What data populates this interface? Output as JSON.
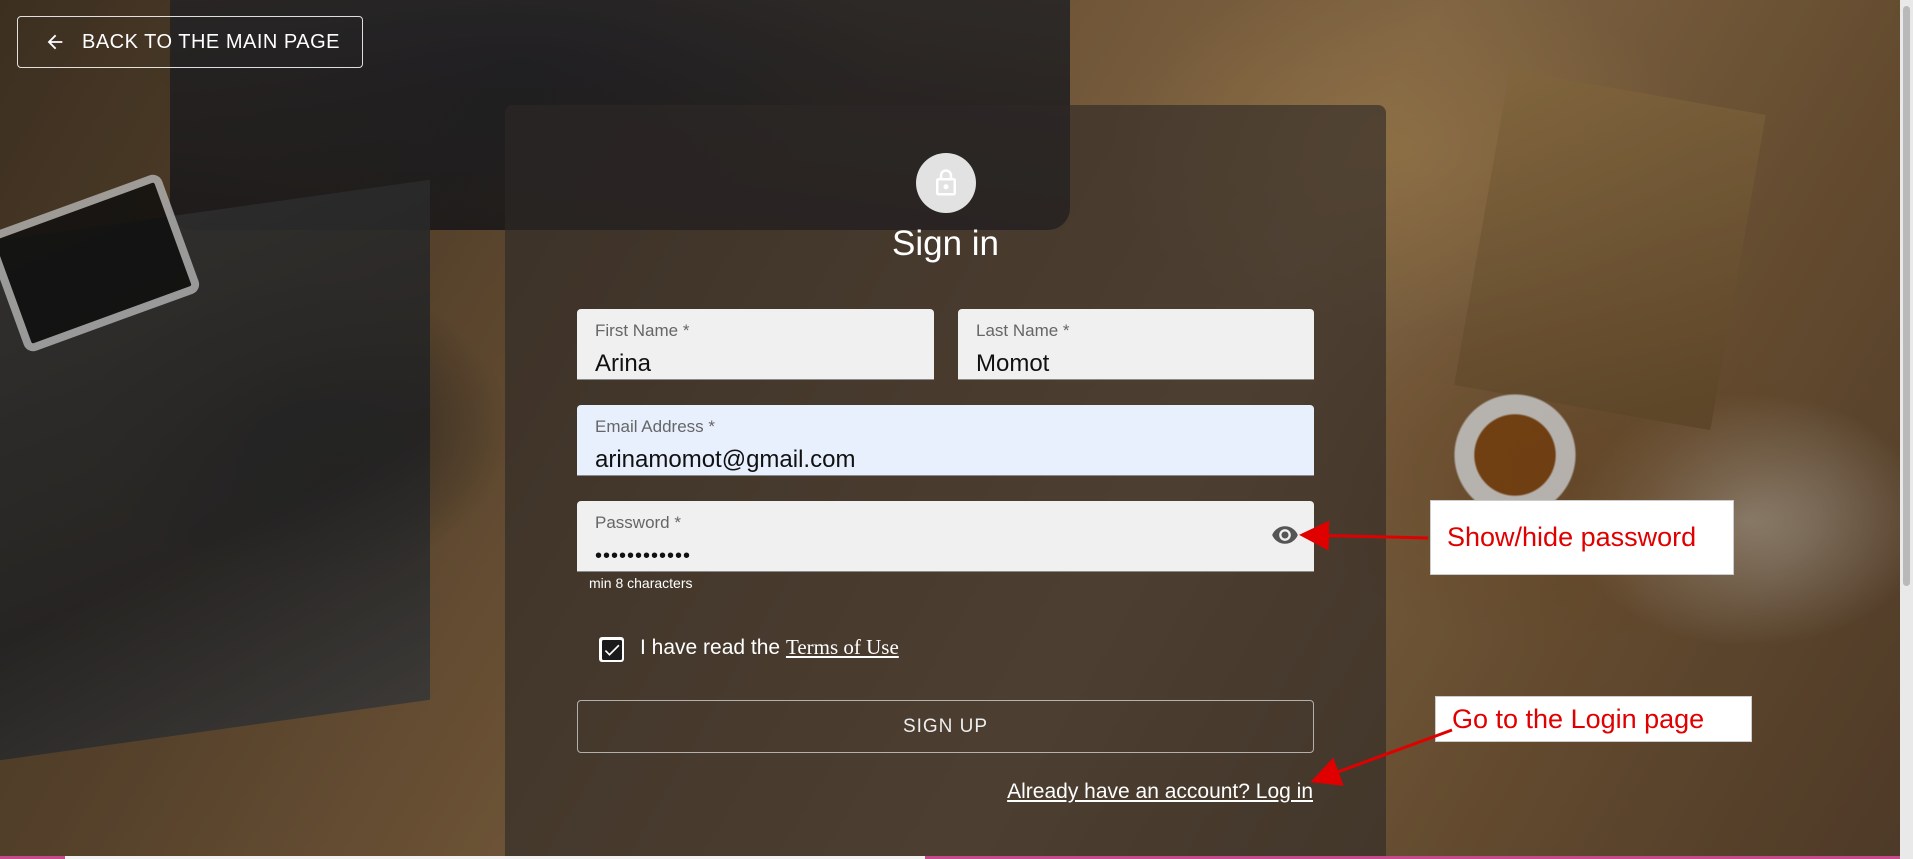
{
  "nav": {
    "back_label": "BACK TO THE MAIN PAGE"
  },
  "form": {
    "title": "Sign in",
    "first_name": {
      "label": "First Name *",
      "value": "Arina"
    },
    "last_name": {
      "label": "Last Name *",
      "value": "Momot"
    },
    "email": {
      "label": "Email Address *",
      "value": "arinamomot@gmail.com"
    },
    "password": {
      "label": "Password *",
      "value": "••••••••••••",
      "helper": "min 8 characters"
    },
    "terms": {
      "checked": true,
      "text": "I have read the",
      "link": "Terms of Use"
    },
    "submit_label": "SIGN UP",
    "login_link": "Already have an account? Log in"
  },
  "annotations": {
    "show_hide": "Show/hide password",
    "go_login": "Go to the Login page"
  },
  "colors": {
    "annotation_red": "#e00000",
    "card_overlay": "rgba(45,40,38,0.62)",
    "autofill_bg": "#e8f0fe",
    "field_bg": "#f0f0f0"
  },
  "icons": [
    "arrow-left-icon",
    "lock-icon",
    "eye-icon",
    "checkmark-icon"
  ]
}
